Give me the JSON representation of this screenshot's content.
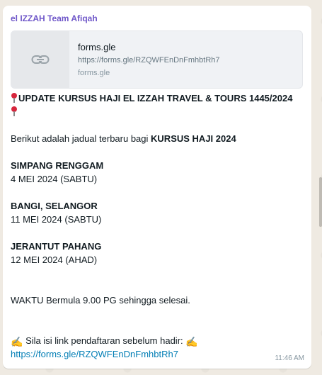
{
  "message": {
    "sender": "el IZZAH Team Afiqah",
    "link_preview": {
      "title": "forms.gle",
      "url": "https://forms.gle/RZQWFEnDnFmhbtRh7",
      "domain": "forms.gle"
    },
    "headline": "UPDATE KURSUS HAJI EL IZZAH TRAVEL & TOURS 1445/2024",
    "intro_prefix": "Berikut adalah jadual terbaru bagi ",
    "intro_bold": "KURSUS HAJI 2024",
    "schedule": [
      {
        "location": "SIMPANG RENGGAM",
        "date": "4 MEI 2024 (SABTU)"
      },
      {
        "location": "BANGI, SELANGOR",
        "date": "11 MEI 2024 (SABTU)"
      },
      {
        "location": "JERANTUT PAHANG",
        "date": "12 MEI 2024 (AHAD)"
      }
    ],
    "time_note": "WAKTU Bermula 9.00 PG sehingga selesai.",
    "register_note": "Sila isi link pendaftaran sebelum hadir:",
    "register_link": "https://forms.gle/RZQWFEnDnFmhbtRh7",
    "timestamp": "11:46 AM"
  },
  "icons": {
    "thumbnail": "link-icon",
    "pin": "round-pushpin-icon",
    "hand": "writing-hand-icon"
  },
  "colors": {
    "sender": "#6f57c9",
    "link": "#027eb5",
    "bubble": "#ffffff",
    "background": "#efeae2"
  }
}
